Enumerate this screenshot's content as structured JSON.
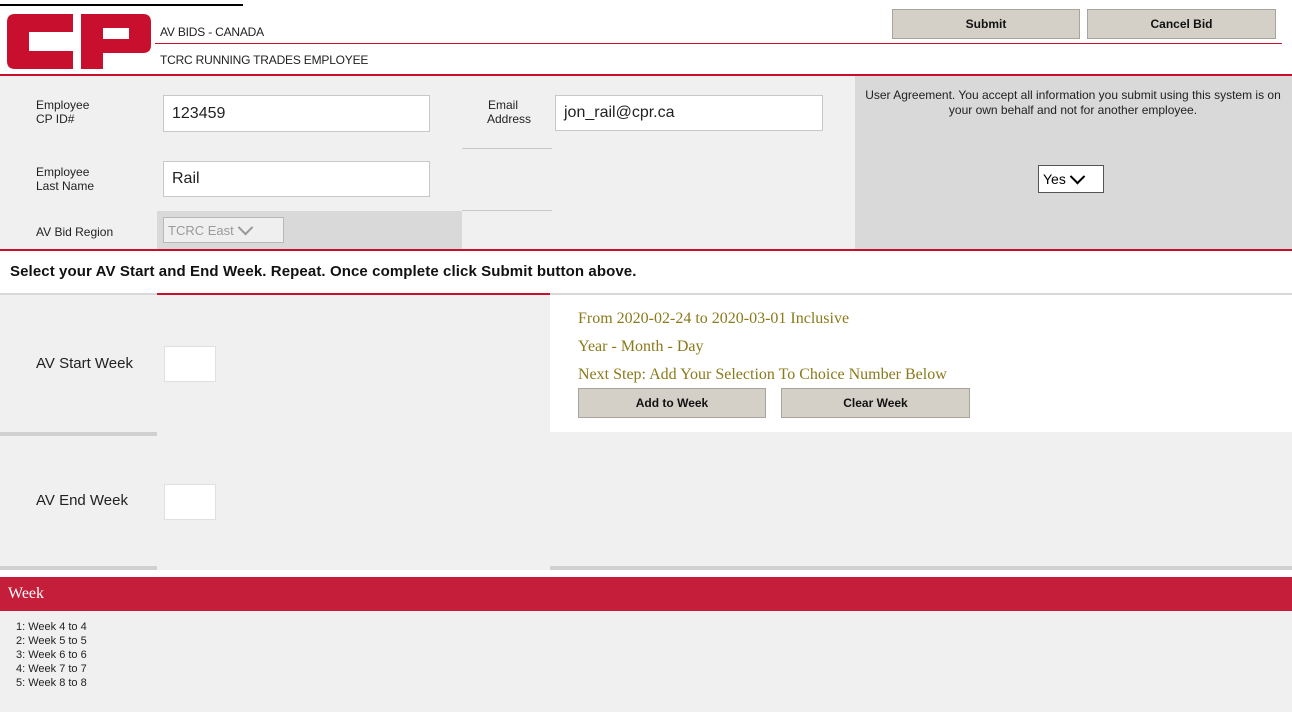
{
  "header": {
    "app_title": "AV BIDS - CANADA",
    "subtitle": "TCRC RUNNING TRADES EMPLOYEE",
    "logo_text": "CP",
    "submit_label": "Submit",
    "cancel_label": "Cancel Bid",
    "brand_color": "#c8102e"
  },
  "form": {
    "employee_id_label_1": "Employee",
    "employee_id_label_2": "CP ID#",
    "employee_id_value": "123459",
    "last_name_label_1": "Employee",
    "last_name_label_2": "Last Name",
    "last_name_value": "Rail",
    "region_label": "AV Bid Region",
    "region_value": "TCRC East",
    "email_label_1": "Email",
    "email_label_2": "Address",
    "email_value": "jon_rail@cpr.ca",
    "agreement_text": "User Agreement. You accept all information you submit using this system is on your own behalf and not for another employee.",
    "agreement_value": "Yes"
  },
  "instruction": "Select your AV Start and End Week. Repeat. Once complete click Submit button above.",
  "weeks_form": {
    "start_label": "AV Start Week",
    "end_label": "AV End Week",
    "range_text": "From 2020-02-24 to 2020-03-01 Inclusive",
    "format_text": "Year - Month - Day",
    "next_step_text": "Next Step: Add Your Selection To Choice Number Below",
    "add_label": "Add to Week",
    "clear_label": "Clear Week"
  },
  "week_list": {
    "title": "Week",
    "items": [
      "1: Week 4 to 4",
      "2: Week 5 to 5",
      "3: Week 6 to 6",
      "4: Week 7 to 7",
      "5: Week 8 to 8"
    ]
  }
}
